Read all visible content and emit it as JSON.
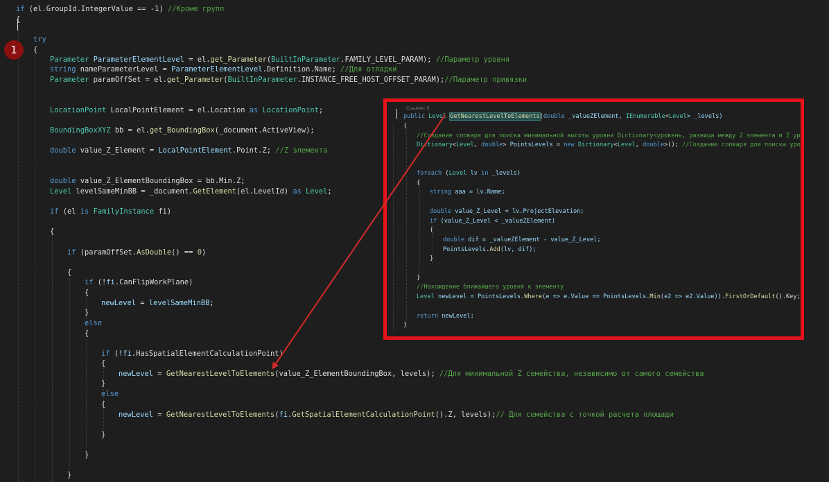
{
  "badge": "1",
  "editor": {
    "lines": {
      "l1": {
        "a": "if",
        "b": " (el.GroupId.IntegerValue == -1) ",
        "c": "//Кроме групп"
      },
      "l2": "{",
      "l3": "try",
      "l4": "{",
      "l5": {
        "a": "Parameter",
        "b": " ParameterElementLevel",
        "c": " = el.",
        "d": "get_Parameter",
        "e": "(",
        "f": "BuiltInParameter",
        "g": ".FAMILY_LEVEL_PARAM); ",
        "h": "//Параметр уровня"
      },
      "l6": {
        "a": "string",
        "b": " nameParameterLevel = ",
        "c": "ParameterElementLevel",
        "d": ".Definition.Name; ",
        "e": "//Для отладки"
      },
      "l7": {
        "a": "Parameter",
        "b": " paramOffSet = el.",
        "c": "get_Parameter",
        "d": "(",
        "e": "BuiltInParameter",
        "f": ".INSTANCE_FREE_HOST_OFFSET_PARAM);",
        "g": "//Параметр привязки"
      },
      "l8": {
        "a": "LocationPoint",
        "b": " LocalPointElement = el.Location ",
        "c": "as",
        "d": " LocationPoint",
        "e": ";"
      },
      "l9": {
        "a": "BoundingBoxXYZ",
        "b": " bb = el.",
        "c": "get_BoundingBox",
        "d": "(_document.ActiveView);"
      },
      "l10": {
        "a": "double",
        "b": " value_Z_Element = ",
        "c": "LocalPointElement",
        "d": ".Point.Z; ",
        "e": "//Z элемента"
      },
      "l11": {
        "a": "double",
        "b": " value_Z_ElementBoundingBox = bb.Min.Z;"
      },
      "l12": {
        "a": "Level",
        "b": " levelSameMinBB = _document.",
        "c": "GetElement",
        "d": "(el.LevelId) ",
        "e": "as",
        "f": " Level",
        "g": ";"
      },
      "l13": {
        "a": "if",
        "b": " (el ",
        "c": "is",
        "d": " FamilyInstance",
        "e": " fi)"
      },
      "l14": "{",
      "l15": {
        "a": "if",
        "b": " (paramOffSet.",
        "c": "AsDouble",
        "d": "() == ",
        "e": "0",
        "f": ")"
      },
      "l16": "{",
      "l17": {
        "a": "if",
        "b": " (!",
        "c": "fi",
        "d": ".CanFlipWorkPlane)"
      },
      "l18": "{",
      "l19": {
        "a": "newLevel",
        "b": " = ",
        "c": "levelSameMinBB",
        "d": ";"
      },
      "l20": "}",
      "l21": "else",
      "l22": "{",
      "l23": {
        "a": "if",
        "b": " (!",
        "c": "fi",
        "d": ".HasSpatialElementCalculationPoint)"
      },
      "l24": "{",
      "l25": {
        "a": "newLevel",
        "b": " = ",
        "c": "GetNearestLevelToElements",
        "d": "(value_Z_ElementBoundingBox, levels); ",
        "e": "//Для минимальной Z семейства, независимо от самого семейства"
      },
      "l26": "}",
      "l27": "else",
      "l28": "{",
      "l29": {
        "a": "newLevel",
        "b": " = ",
        "c": "GetNearestLevelToElements",
        "d": "(",
        "e": "fi",
        "f": ".",
        "g": "GetSpatialElementCalculationPoint",
        "h": "().Z, levels);",
        "i": "// Для семейства с точкой расчета площади"
      },
      "l30": "}",
      "l31": "}",
      "l32": "}"
    }
  },
  "popup": {
    "refs": "Ссылок: 5",
    "p1": {
      "a": "public",
      "b": " Level ",
      "c": "GetNearestLevelToElements",
      "d": "(",
      "e": "double",
      "f": " _valueZElement, ",
      "g": "IEnumerable",
      "h": "<",
      "i": "Level",
      "j": "> _levels)"
    },
    "p2": "{",
    "p3": "//Создание словаря для поиска минимальной высоты уровня Dictionary<уровень, разница между Z элемента и Z уров",
    "p4": {
      "a": "Dictionary",
      "b": "<",
      "c": "Level",
      "d": ", ",
      "e": "double",
      "f": "> ",
      "g": "PointsLevels",
      "h": " = ",
      "i": "new",
      "j": " Dictionary",
      "k": "<",
      "l": "Level",
      "m": ", ",
      "n": "double",
      "o": ">(); ",
      "p": "//Создание словаря для поиска уров"
    },
    "p5": {
      "a": "foreach",
      "b": " (",
      "c": "Level",
      "d": " lv ",
      "e": "in",
      "f": " _levels)"
    },
    "p6": "{",
    "p7": {
      "a": "string",
      "b": " aaa = lv.Name;"
    },
    "p8": {
      "a": "double",
      "b": " value_Z_Level = lv.ProjectElevation;"
    },
    "p9": {
      "a": "if",
      "b": " (value_Z_Level < _valueZElement)"
    },
    "p10": "{",
    "p11": {
      "a": "double",
      "b": " dif = _valueZElement - value_Z_Level;"
    },
    "p12": {
      "a": "PointsLevels",
      "b": ".",
      "c": "Add",
      "d": "(lv, dif);"
    },
    "p13": "}",
    "p14": "}",
    "p15": "//Нахождение ближайшего уровня к элементу",
    "p16": {
      "a": "Level",
      "b": " newLevel = ",
      "c": "PointsLevels",
      "d": ".",
      "e": "Where",
      "f": "(e => e.Value == ",
      "g": "PointsLevels",
      "h": ".",
      "i": "Min",
      "j": "(e2 => e2.Value)).",
      "k": "FirstOrDefault",
      "l": "().Key;"
    },
    "p17": {
      "a": "return",
      "b": " newLevel;"
    },
    "p18": "}"
  },
  "colors": {
    "background": "#1e1e1e",
    "keyword": "#569cd6",
    "type": "#4ec9b0",
    "method": "#dcdcaa",
    "variable": "#9cdcfe",
    "comment": "#57a64a",
    "highlight_box": "#e5121a",
    "arrow": "#d42a2a",
    "badge": "#8b1010"
  }
}
